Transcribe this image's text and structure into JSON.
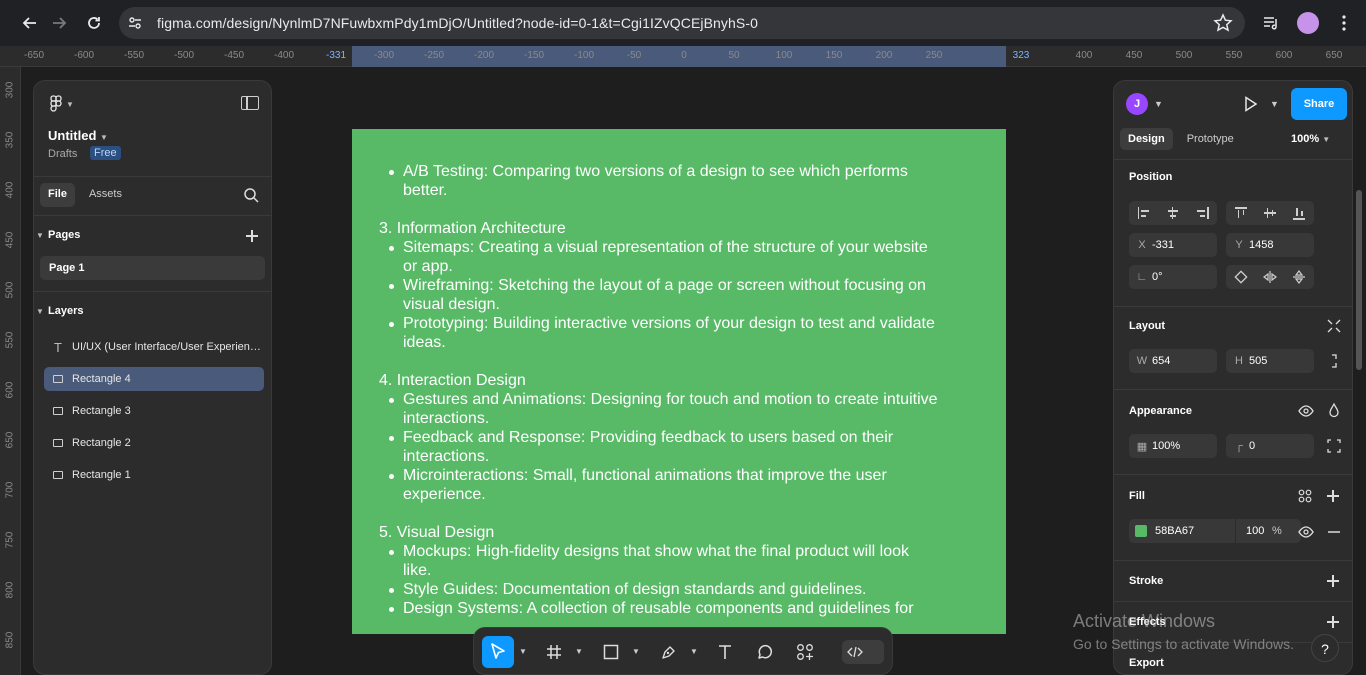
{
  "browser": {
    "url": "figma.com/design/NynlmD7NFuwbxmPdy1mDjO/Untitled?node-id=0-1&t=Cgi1IZvQCEjBnyhS-0"
  },
  "ruler_top": [
    "-650",
    "-600",
    "-550",
    "-500",
    "-450",
    "-400",
    "-331",
    "-300",
    "-250",
    "-200",
    "-150",
    "-100",
    "-50",
    "0",
    "50",
    "100",
    "150",
    "200",
    "250",
    "323",
    "400",
    "450",
    "500",
    "550",
    "600",
    "650"
  ],
  "ruler_left": [
    "300",
    "350",
    "400",
    "450",
    "500",
    "550",
    "600",
    "650",
    "700",
    "750",
    "800",
    "850"
  ],
  "left_panel": {
    "file_title": "Untitled",
    "drafts_label": "Drafts",
    "plan_badge": "Free",
    "tabs": [
      "File",
      "Assets"
    ],
    "pages_header": "Pages",
    "pages": [
      "Page 1"
    ],
    "layers_header": "Layers",
    "layers": [
      "UI/UX (User Interface/User Experience)",
      "Rectangle 4",
      "Rectangle 3",
      "Rectangle 2",
      "Rectangle 1"
    ]
  },
  "frame_content": {
    "bg_color": "#58BA67",
    "line1a": "A/B Testing: Comparing two versions of a design to see which performs",
    "line1b": "better.",
    "h3": "3. Information Architecture",
    "s3_1a": "Sitemaps: Creating a visual representation of the structure of your website",
    "s3_1b": "or app.",
    "s3_2a": "Wireframing: Sketching the layout of a page or screen without focusing on",
    "s3_2b": "visual design.",
    "s3_3a": "Prototyping: Building interactive versions of your design to test and validate",
    "s3_3b": "ideas.",
    "h4": "4. Interaction Design",
    "s4_1a": "Gestures and Animations: Designing for touch and motion to create intuitive",
    "s4_1b": "interactions.",
    "s4_2a": "Feedback and Response: Providing feedback to users based on their",
    "s4_2b": "interactions.",
    "s4_3a": "Microinteractions: Small, functional animations that improve the user",
    "s4_3b": "experience.",
    "h5": "5. Visual Design",
    "s5_1a": "Mockups: High-fidelity designs that show what the final product will look",
    "s5_1b": "like.",
    "s5_2": "Style Guides: Documentation of design standards and guidelines.",
    "s5_3": "Design Systems: A collection of reusable components and guidelines for"
  },
  "right_panel": {
    "avatar_initial": "J",
    "share_label": "Share",
    "tabs": [
      "Design",
      "Prototype"
    ],
    "zoom": "100%",
    "position_header": "Position",
    "x_label": "X",
    "x_value": "-331",
    "y_label": "Y",
    "y_value": "1458",
    "rotation_value": "0°",
    "layout_header": "Layout",
    "w_label": "W",
    "w_value": "654",
    "h_label": "H",
    "h_value": "505",
    "appearance_header": "Appearance",
    "opacity_value": "100%",
    "radius_value": "0",
    "fill_header": "Fill",
    "fill_hex": "58BA67",
    "fill_opacity": "100",
    "fill_percent": "%",
    "stroke_header": "Stroke",
    "effects_header": "Effects",
    "export_header": "Export"
  },
  "watermark": {
    "line1": "Activate Windows",
    "line2": "Go to Settings to activate Windows."
  },
  "help_label": "?"
}
